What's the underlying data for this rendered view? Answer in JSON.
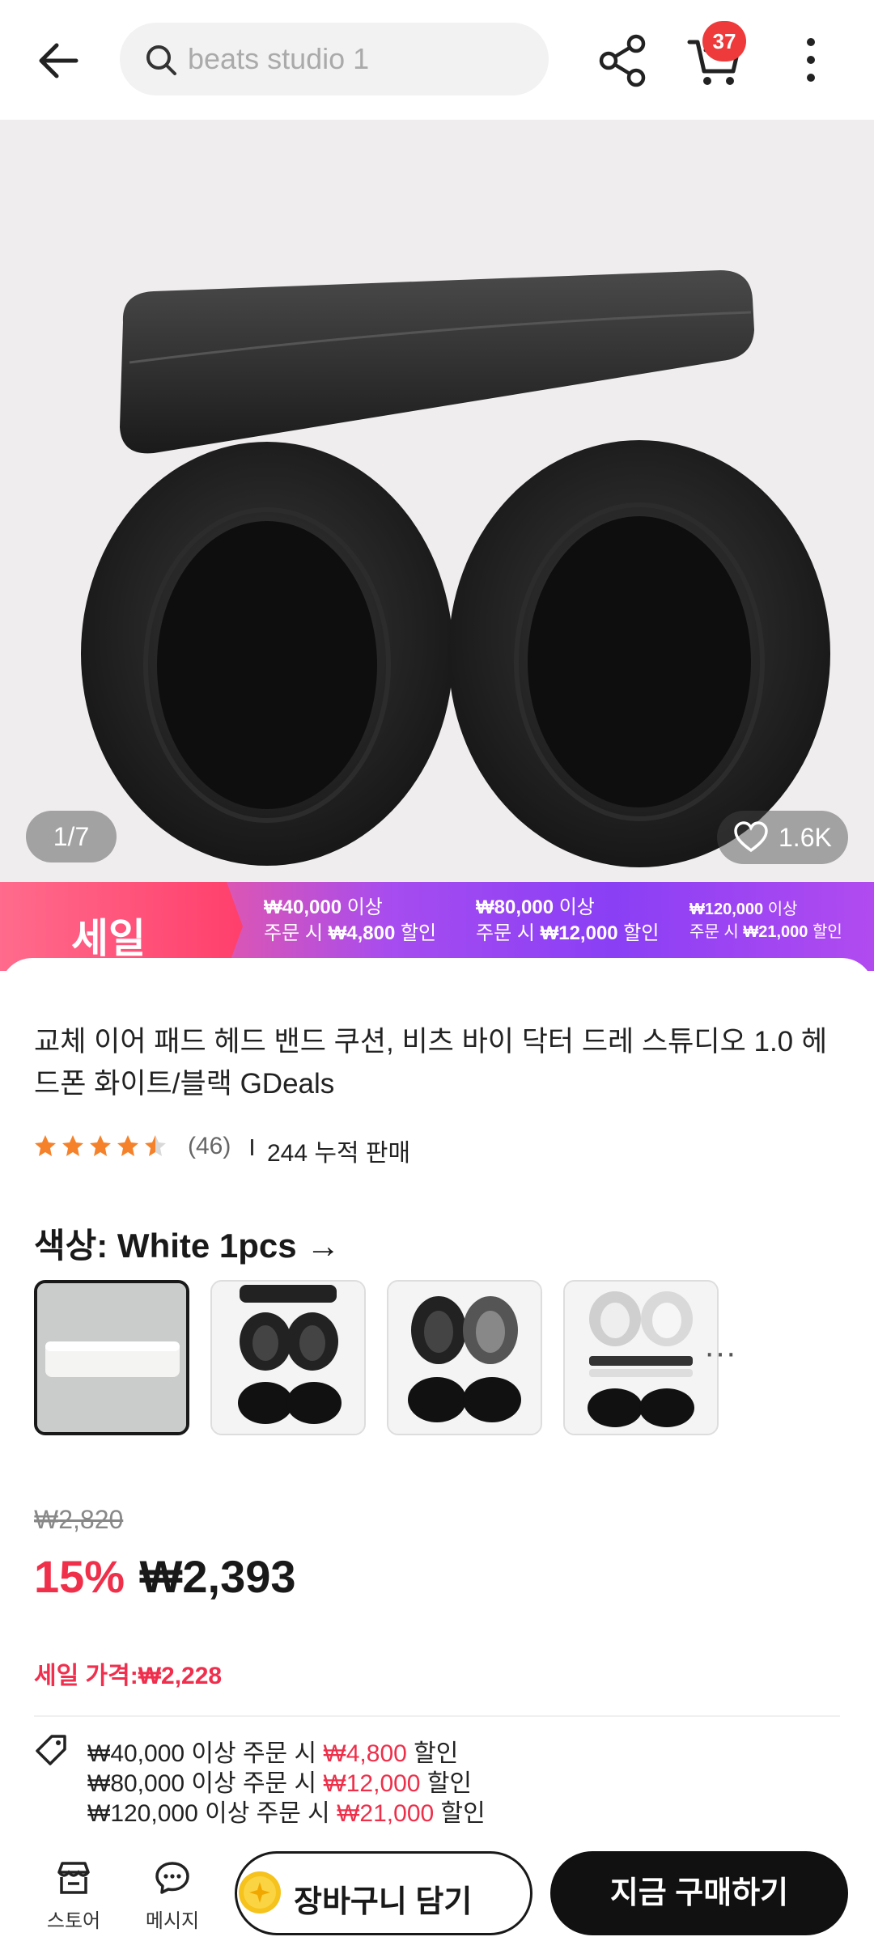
{
  "header": {
    "search_value": "beats studio 1",
    "cart_count": "37"
  },
  "gallery": {
    "pager": "1/7",
    "likes": "1.6K"
  },
  "sale_banner": {
    "label": "세일",
    "tiers": [
      {
        "threshold": "₩40,000",
        "suffix1": " 이상",
        "prefix2": "주문 시 ",
        "discount": "₩4,800",
        "suffix2": " 할인"
      },
      {
        "threshold": "₩80,000",
        "suffix1": " 이상",
        "prefix2": "주문 시 ",
        "discount": "₩12,000",
        "suffix2": " 할인"
      },
      {
        "threshold": "₩120,000",
        "suffix1": " 이상",
        "prefix2": "주문 시 ",
        "discount": "₩21,000",
        "suffix2": " 할인"
      }
    ]
  },
  "product": {
    "title": "교체 이어 패드 헤드 밴드 쿠션, 비츠 바이 닥터 드레 스튜디오 1.0 헤드폰 화이트/블랙 GDeals",
    "rating_value": 4.5,
    "rating_count": "(46)",
    "sold": "244 누적 판매",
    "color_label": "색상: White 1pcs",
    "color_arrow": "→",
    "more_swatches": "···",
    "original_price": "₩2,820",
    "discount_pct": "15%",
    "price": "₩2,393",
    "sale_price": "세일 가격:₩2,228"
  },
  "coupons": [
    {
      "text": "₩40,000 이상 주문 시 ",
      "amount": "₩4,800",
      "suffix": " 할인"
    },
    {
      "text": "₩80,000 이상 주문 시 ",
      "amount": "₩12,000",
      "suffix": " 할인"
    },
    {
      "text": "₩120,000 이상 주문 시 ",
      "amount": "₩21,000",
      "suffix": " 할인"
    }
  ],
  "bottom_bar": {
    "store": "스토어",
    "message": "메시지",
    "add_to_cart": "장바구니 담기",
    "buy_now": "지금 구매하기"
  },
  "colors": {
    "accent_red": "#f0304a",
    "badge_red": "#ee3a3a",
    "banner_pink": "#ff4d80",
    "banner_purple": "#8a3ff5",
    "star_orange": "#f5822a"
  }
}
